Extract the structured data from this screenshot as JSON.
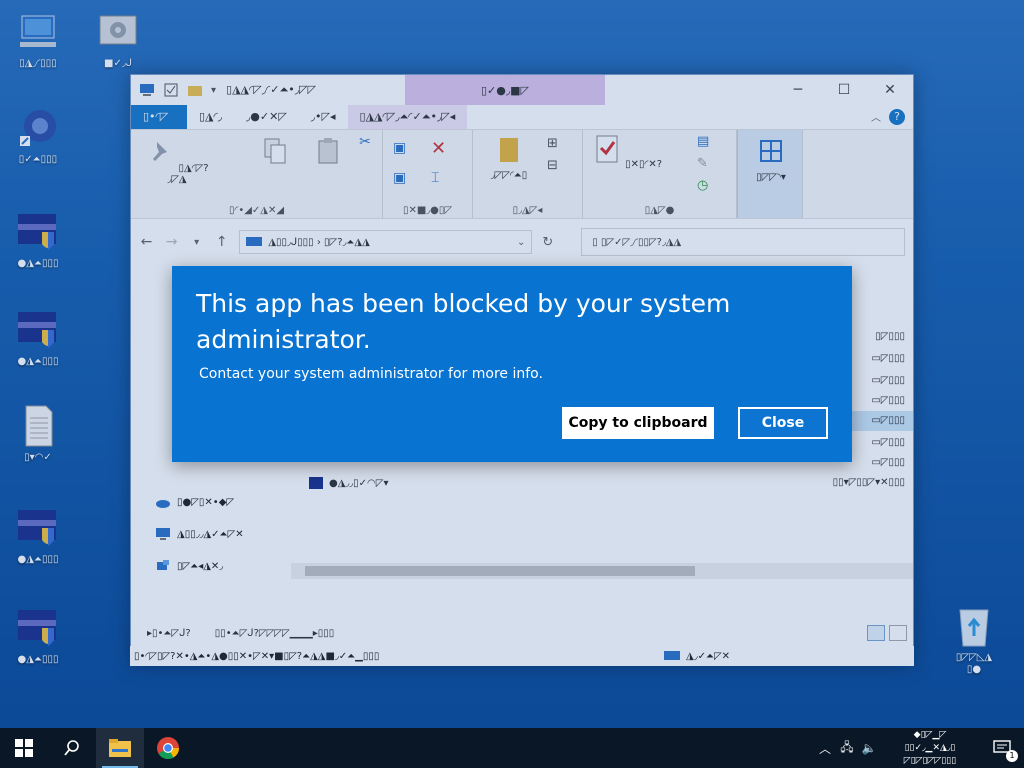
{
  "dialog": {
    "title": "This app has been blocked by your system administrator.",
    "message": "Contact your system administrator for more info.",
    "copy_button": "Copy to clipboard",
    "close_button": "Close"
  },
  "desktop": {
    "icons": [
      {
        "label": "▯◮◞◜▯▯▯"
      },
      {
        "label": "■✓◞ᒍ"
      },
      {
        "label": "▯✓⏶▯▯▯"
      },
      {
        "label": "●◮⏶▯▯▯"
      },
      {
        "label": "●◮⏶▯▯▯"
      },
      {
        "label": "▯▾◠✓"
      },
      {
        "label": "●◮⏶▯▯▯"
      },
      {
        "label": "●◮⏶▯▯▯"
      },
      {
        "label": "▯◸◸◺◮"
      },
      {
        "label": "▯●"
      }
    ]
  },
  "explorer": {
    "manage_label": "▯✓●◞■◸",
    "title": "▯◮◮◜◸◞◜✓⏶•◞◸◸",
    "tabs": [
      "▯•◜◸",
      "▯◮◜◞",
      "◞●✓✕◸",
      "◞•◸◂",
      "▯◮◮◜◸◞⏶◜✓⏶•◞◸◂"
    ],
    "ribbon_groups": [
      "▯◜•◢✓◮✕◢",
      "▯✕■◞●▯◸",
      "▯◞◮◸◂",
      "▯◮◸●"
    ],
    "ribbon_buttons": [
      "▯◮◜◸?◞◸◮",
      "◸◸◢◸?◜▯◸",
      "◞◸◸◜⏶▯",
      "◢◸◝◸✕",
      "▯✕▯◜✕?",
      "▯◸◸◝▾"
    ],
    "address": "◮▯▯◞ᒍ▯▯▯  ›  ▯◸?◞⏶◮◮",
    "search_placeholder": "▯  ▯◸✓◸◞◜▯▯◸?◞◮◮",
    "nav_items": [
      "▯●◸▯✕•◆◸",
      "◮▯▯◞◞◮✓⏶◸✕",
      "▯◸⏶◂◮✕◞",
      "▯◞ᒍ◜◮?"
    ],
    "file_rows": [
      {
        "name": "",
        "type": "▯◸▯▯▯"
      },
      {
        "name": "",
        "type": "▭◸▯▯▯"
      },
      {
        "name": "",
        "type": "▭◸▯▯▯"
      },
      {
        "name": "",
        "type": "▭◸▯▯▯"
      },
      {
        "name": "",
        "type": "▭◸▯▯▯"
      },
      {
        "name": "",
        "type": "▭◸▯▯▯"
      },
      {
        "name": "",
        "type": "▭◸▯▯▯"
      },
      {
        "name": "●◮◞◞▯✓◠◸▾",
        "type": "▯▯▾◸▯▯◸▾✕▯▯▯"
      }
    ],
    "status_left": "▸▯•⏶◸ᒍ?",
    "status_mid": "▯▯•⏶◸ᒍ?◸◸◸◸▁▁▁▸▯▯▯",
    "detail_left": "▯•◜◸▯◸?✕•◮⏶•◮●▯▯✕•◸✕▾■▯◸?⏶◮◮■◞✓⏶▁▯▯▯",
    "detail_right": "◮◞✓⏶◸✕"
  },
  "taskbar": {
    "clock_time": "◆▯◸▁◸",
    "clock_date": "▯▯✓◞▁✕◮◞▯",
    "clock_line3": "◸▯◸▯◸◸▯▯▯",
    "notification_count": "1"
  }
}
